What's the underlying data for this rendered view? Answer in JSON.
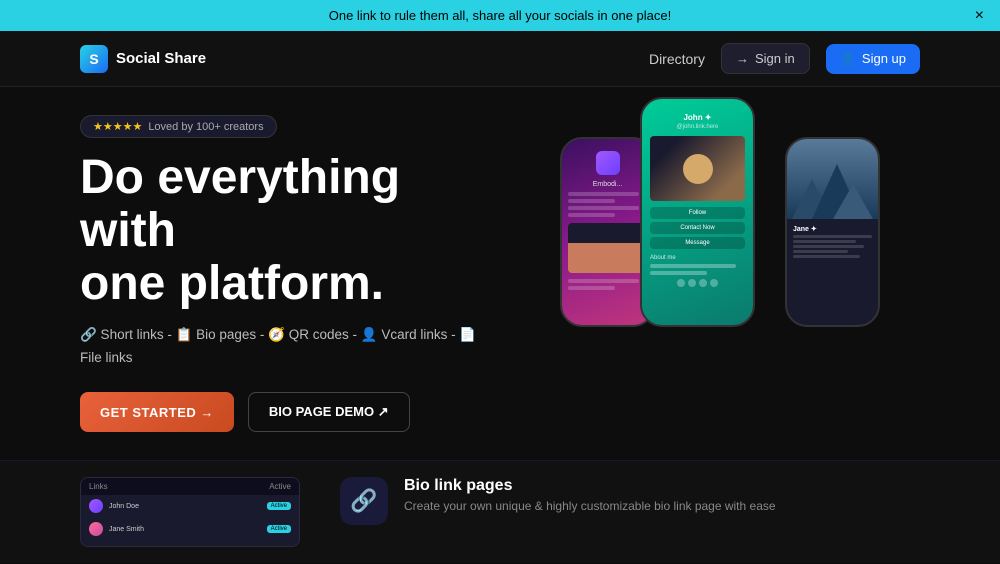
{
  "banner": {
    "text": "One link to rule them all, share all your socials in one place!",
    "close_label": "×"
  },
  "navbar": {
    "logo_letter": "S",
    "brand_name": "Social Share",
    "directory_label": "Directory",
    "signin_label": "Sign in",
    "signup_label": "Sign up"
  },
  "hero": {
    "badge_stars": "★★★★★",
    "badge_text": "Loved by 100+ creators",
    "heading_line1": "Do everything with",
    "heading_line2": "one platform.",
    "subtext": "🔗 Short links -  📋 Bio pages -  🧭 QR codes -  👤 Vcard links -  📄 File links",
    "cta_primary": "GET STARTED →",
    "cta_secondary": "BIO PAGE DEMO ↗"
  },
  "phones": {
    "left": {
      "app_label": "Embodi..."
    },
    "center": {
      "name": "John ✦",
      "handle": "@john.link.here",
      "btn1": "Follow",
      "btn2": "Contact Now",
      "btn3": "Message",
      "about_label": "About me"
    },
    "right": {
      "name": "Jane ✦"
    }
  },
  "bottom_section": {
    "card_title": "Bio link pages",
    "card_desc": "Create your own unique & highly customizable bio link page with ease",
    "card_icon": "🔗",
    "dashboard": {
      "header_left": "Links",
      "header_right": "Active",
      "row1_name": "John Doe",
      "row1_badge": "Active",
      "row2_name": "Jane Smith",
      "row2_badge": "Active"
    }
  }
}
